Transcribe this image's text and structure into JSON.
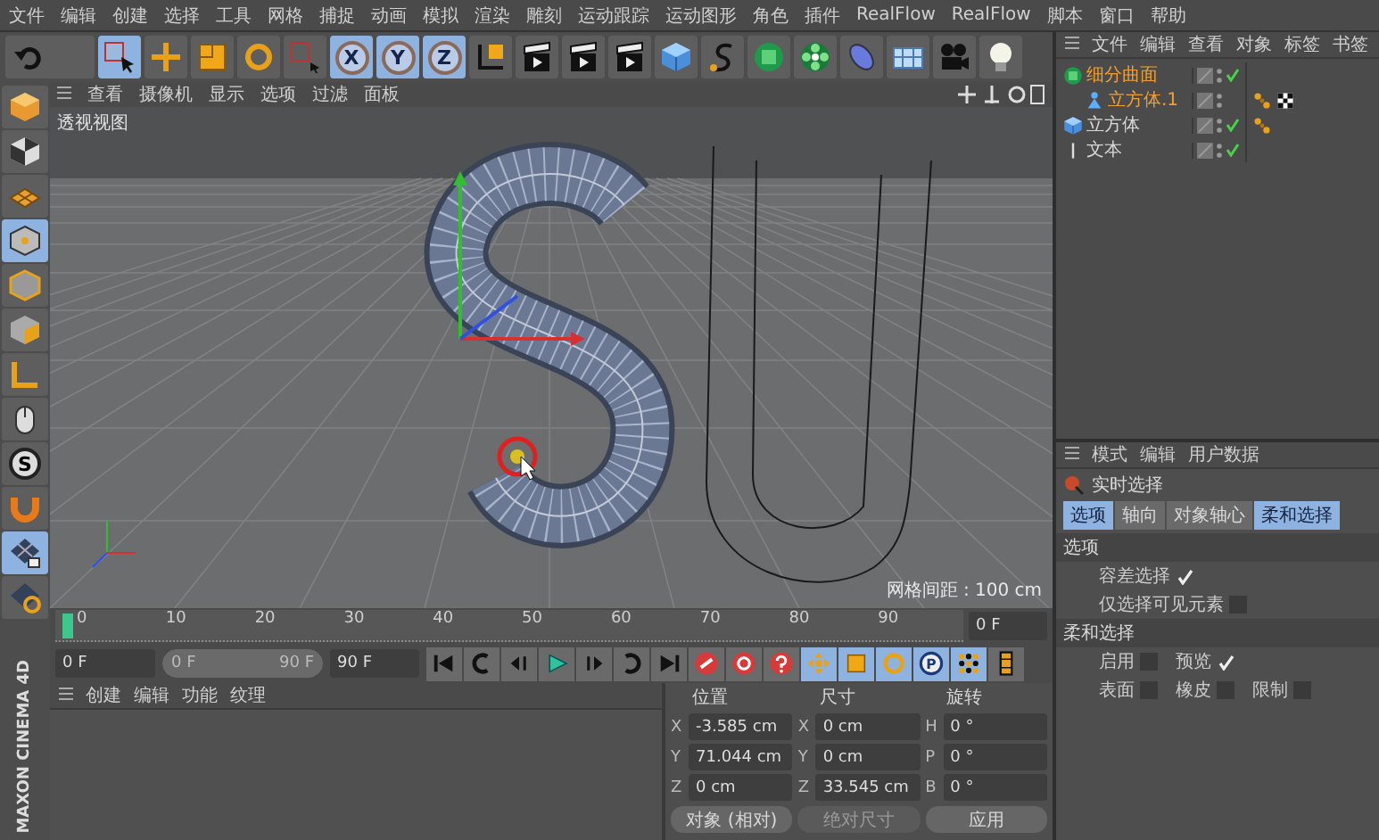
{
  "menu": [
    "文件",
    "编辑",
    "创建",
    "选择",
    "工具",
    "网格",
    "捕捉",
    "动画",
    "模拟",
    "渲染",
    "雕刻",
    "运动跟踪",
    "运动图形",
    "角色",
    "插件",
    "RealFlow",
    "RealFlow",
    "脚本",
    "窗口",
    "帮助"
  ],
  "toolbar": [
    {
      "kind": "undo",
      "selected": false
    },
    {
      "kind": "select",
      "selected": true
    },
    {
      "kind": "move",
      "selected": false
    },
    {
      "kind": "scale",
      "selected": false
    },
    {
      "kind": "rotate",
      "selected": false
    },
    {
      "kind": "select-menu",
      "selected": false
    },
    {
      "kind": "axis",
      "label": "X",
      "selected": true
    },
    {
      "kind": "axis",
      "label": "Y",
      "selected": true
    },
    {
      "kind": "axis",
      "label": "Z",
      "selected": true
    },
    {
      "kind": "coords",
      "selected": false
    },
    {
      "kind": "clapper",
      "selected": false
    },
    {
      "kind": "clapper",
      "selected": false
    },
    {
      "kind": "clapper",
      "selected": false
    },
    {
      "kind": "cube",
      "selected": false
    },
    {
      "kind": "pen",
      "selected": false
    },
    {
      "kind": "subdiv",
      "selected": false
    },
    {
      "kind": "cloner",
      "selected": false
    },
    {
      "kind": "deformer",
      "selected": false
    },
    {
      "kind": "floor",
      "selected": false
    },
    {
      "kind": "camera",
      "selected": false
    },
    {
      "kind": "light",
      "selected": false
    }
  ],
  "left_tools": [
    {
      "kind": "model",
      "selected": false
    },
    {
      "kind": "texture",
      "selected": false
    },
    {
      "kind": "workplane",
      "selected": false
    },
    {
      "kind": "points",
      "selected": true
    },
    {
      "kind": "edges",
      "selected": false
    },
    {
      "kind": "polygons",
      "selected": false
    },
    {
      "kind": "axis-mode",
      "selected": false
    },
    {
      "kind": "mouse",
      "selected": false
    },
    {
      "kind": "snap",
      "label": "S",
      "selected": false
    },
    {
      "kind": "magnet",
      "selected": false
    },
    {
      "kind": "lock-grid",
      "selected": true
    },
    {
      "kind": "grid-rotate",
      "selected": false
    }
  ],
  "logo": "MAXON CINEMA 4D",
  "viewport": {
    "menu": [
      "查看",
      "摄像机",
      "显示",
      "选项",
      "过滤",
      "面板"
    ],
    "label": "透视视图",
    "grid_spacing": "网格间距 : 100 cm"
  },
  "object_manager": {
    "menu": [
      "文件",
      "编辑",
      "查看",
      "对象",
      "标签",
      "书签"
    ],
    "objects": [
      {
        "name": "细分曲面",
        "kind": "subdiv",
        "selected": true,
        "enabled": true,
        "children": [
          {
            "name": "立方体.1",
            "kind": "poly",
            "selected": true,
            "enabled": false,
            "tags": [
              {
                "kind": "phong"
              },
              {
                "kind": "checker"
              }
            ]
          }
        ]
      },
      {
        "name": "立方体",
        "kind": "cube",
        "selected": false,
        "enabled": true,
        "tags": [
          {
            "kind": "phong"
          }
        ]
      },
      {
        "name": "文本",
        "kind": "text",
        "selected": false,
        "enabled": true
      }
    ]
  },
  "attributes": {
    "menu": [
      "模式",
      "编辑",
      "用户数据"
    ],
    "tool": "实时选择",
    "tabs": [
      {
        "label": "选项",
        "selected": true
      },
      {
        "label": "轴向",
        "selected": false
      },
      {
        "label": "对象轴心",
        "selected": false
      },
      {
        "label": "柔和选择",
        "selected": true
      }
    ],
    "sections": [
      {
        "title": "选项",
        "rows": [
          [
            {
              "label": "容差选择",
              "checked": true
            }
          ],
          [
            {
              "label": "仅选择可见元素",
              "checked": false
            }
          ]
        ]
      },
      {
        "title": "柔和选择",
        "rows": [
          [
            {
              "label": "启用",
              "checked": false
            },
            {
              "label": "预览",
              "checked": true
            }
          ],
          [
            {
              "label": "表面",
              "checked": false
            },
            {
              "label": "橡皮",
              "checked": false
            },
            {
              "label": "限制",
              "checked": false
            }
          ]
        ]
      }
    ]
  },
  "timeline": {
    "ticks": [
      "0",
      "10",
      "20",
      "30",
      "40",
      "50",
      "60",
      "70",
      "80",
      "90"
    ],
    "current": "0 F"
  },
  "playback": {
    "start": "0 F",
    "range_start": "0 F",
    "range_end": "90 F",
    "level": 1,
    "end": "90 F",
    "buttons": [
      {
        "kind": "first",
        "selected": false
      },
      {
        "kind": "prev-key",
        "selected": false
      },
      {
        "kind": "prev-frame",
        "selected": false
      },
      {
        "kind": "play",
        "selected": false
      },
      {
        "kind": "next-frame",
        "selected": false
      },
      {
        "kind": "next-key",
        "selected": false
      },
      {
        "kind": "last",
        "selected": false
      },
      {
        "kind": "record",
        "selected": false
      },
      {
        "kind": "autokey",
        "selected": false
      },
      {
        "kind": "keysel",
        "selected": false
      },
      {
        "kind": "key-move",
        "selected": true
      },
      {
        "kind": "key-scale",
        "selected": true
      },
      {
        "kind": "key-rotate",
        "selected": true
      },
      {
        "kind": "key-param",
        "label": "P",
        "selected": true
      },
      {
        "kind": "key-pla",
        "selected": true
      },
      {
        "kind": "timeline",
        "selected": false
      }
    ]
  },
  "materials": {
    "menu": [
      "创建",
      "编辑",
      "功能",
      "纹理"
    ]
  },
  "coordinates": {
    "headers": [
      "位置",
      "尺寸",
      "旋转"
    ],
    "rows": [
      [
        {
          "axis": "X",
          "value": "-3.585 cm"
        },
        {
          "axis": "X",
          "value": "0 cm"
        },
        {
          "axis": "H",
          "value": "0 °"
        }
      ],
      [
        {
          "axis": "Y",
          "value": "71.044 cm"
        },
        {
          "axis": "Y",
          "value": "0 cm"
        },
        {
          "axis": "P",
          "value": "0 °"
        }
      ],
      [
        {
          "axis": "Z",
          "value": "0 cm"
        },
        {
          "axis": "Z",
          "value": "33.545 cm"
        },
        {
          "axis": "B",
          "value": "0 °"
        }
      ]
    ],
    "mode": "对象 (相对)",
    "size_mode": "绝对尺寸",
    "apply": "应用"
  }
}
